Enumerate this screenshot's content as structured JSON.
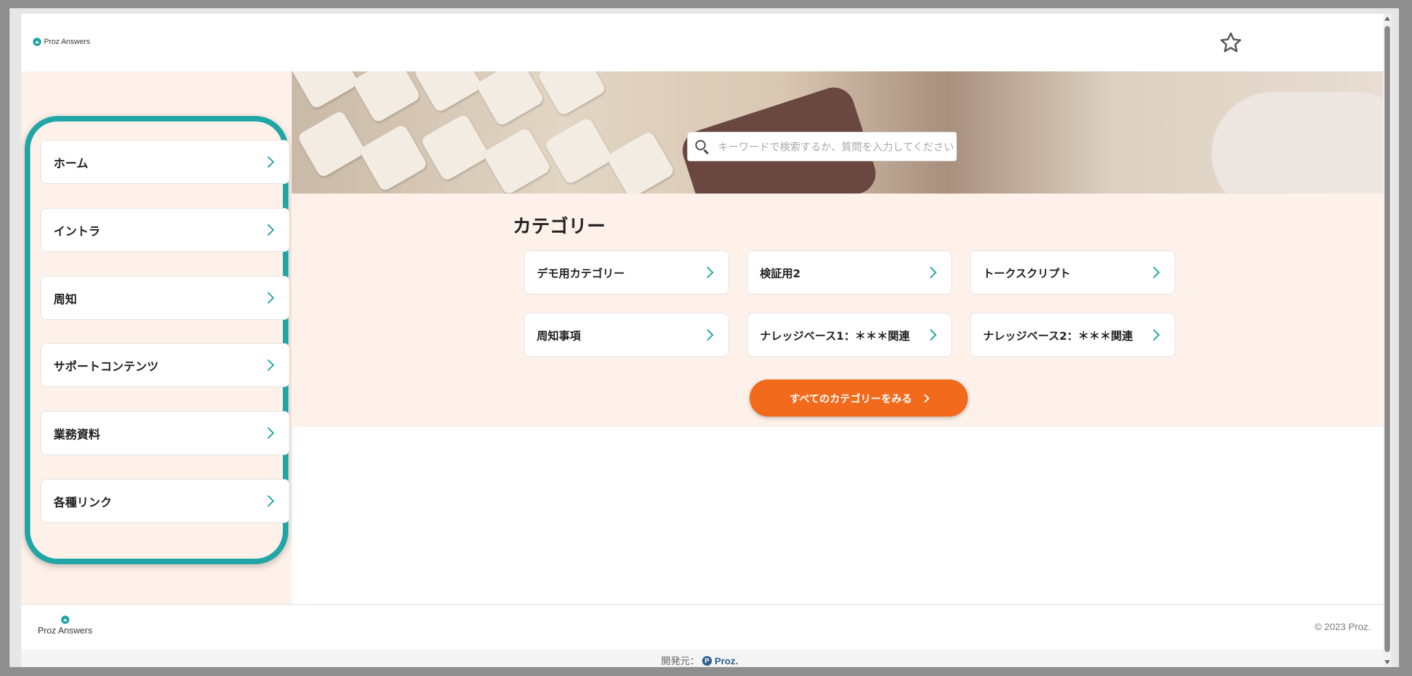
{
  "header": {
    "brand_small": "Proz Answers",
    "favorite_icon": "star-outline-icon"
  },
  "search": {
    "placeholder": "キーワードで検索するか、質問を入力してください",
    "value": ""
  },
  "sidebar": {
    "items": [
      {
        "label": "ホーム"
      },
      {
        "label": "イントラ"
      },
      {
        "label": "周知"
      },
      {
        "label": "サポートコンテンツ"
      },
      {
        "label": "業務資料"
      },
      {
        "label": "各種リンク"
      }
    ]
  },
  "categories": {
    "title": "カテゴリー",
    "items": [
      {
        "label": "デモ用カテゴリー"
      },
      {
        "label": "検証用2"
      },
      {
        "label": "トークスクリプト"
      },
      {
        "label": "周知事項"
      },
      {
        "label": "ナレッジベース1：＊＊＊関連"
      },
      {
        "label": "ナレッジベース2：＊＊＊関連"
      }
    ],
    "view_all_label": "すべてのカテゴリーをみる"
  },
  "footer": {
    "brand": "Proz Answers",
    "copyright": "© 2023 Proz.",
    "developer_label": "開発元：",
    "developer_name": "Proz."
  },
  "colors": {
    "accent": "#1fa6a5",
    "button": "#f26a1b",
    "panel_background": "#fdf1ea"
  }
}
